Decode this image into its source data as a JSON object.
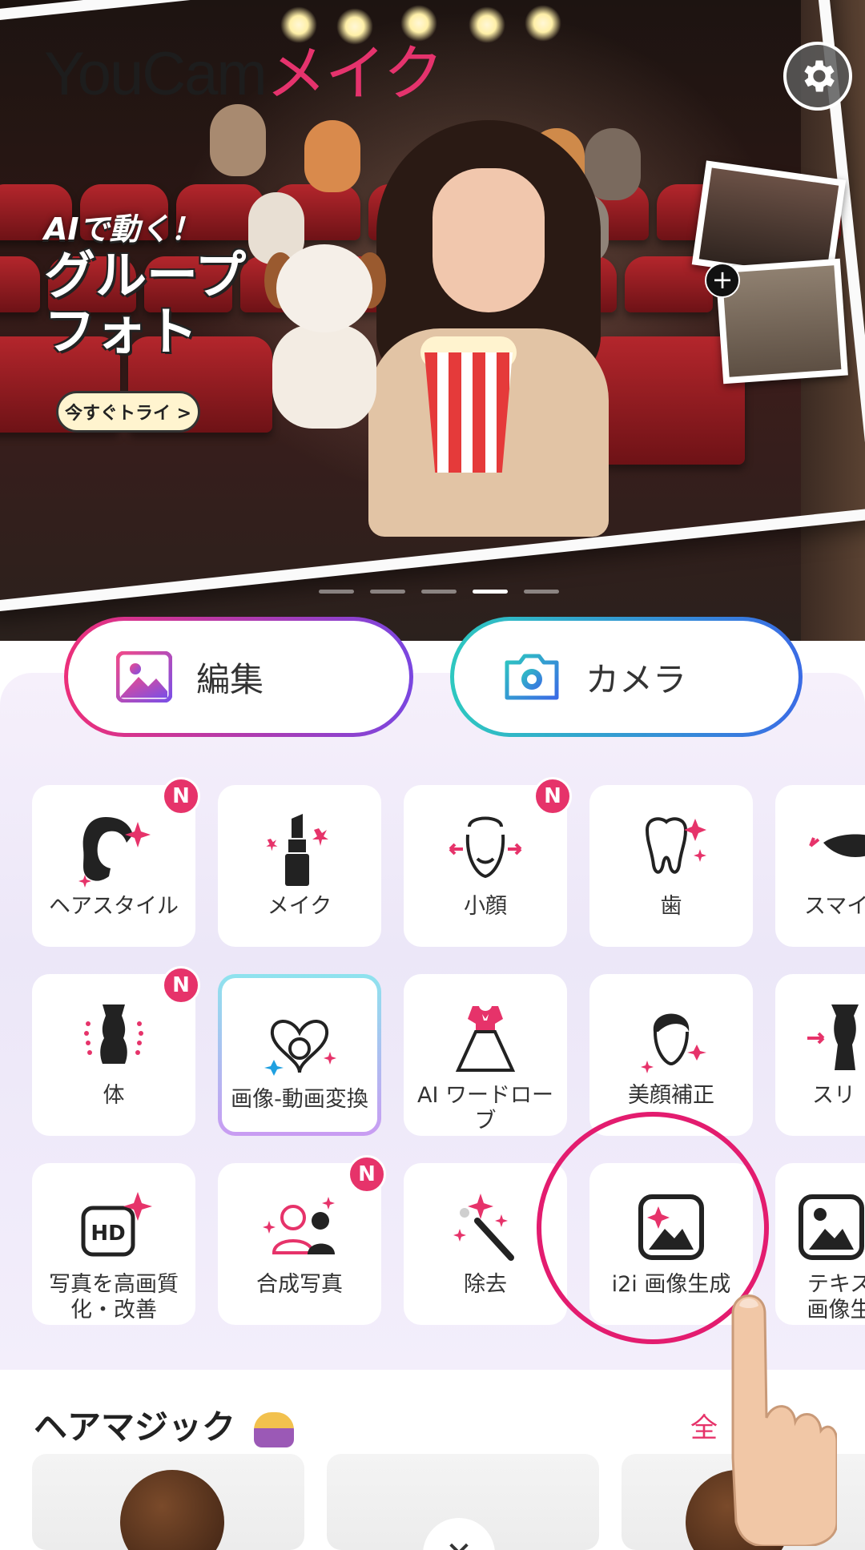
{
  "hero": {
    "logo_part1": "YouCam",
    "logo_part2": "メイク",
    "promo_line1": "AIで動く！",
    "promo_line2": "グループ\nフォト",
    "try_label": "今すぐトライ >",
    "carousel_active_index": 3,
    "carousel_count": 5
  },
  "actions": {
    "edit_label": "編集",
    "camera_label": "カメラ"
  },
  "features": {
    "row1": [
      {
        "label": "ヘアスタイル",
        "icon": "hairstyle-icon",
        "new": true
      },
      {
        "label": "メイク",
        "icon": "lipstick-icon",
        "new": false
      },
      {
        "label": "小顔",
        "icon": "face-slim-icon",
        "new": true
      },
      {
        "label": "歯",
        "icon": "tooth-icon",
        "new": false
      },
      {
        "label": "スマイ",
        "icon": "smile-lips-icon",
        "new": false
      }
    ],
    "row2": [
      {
        "label": "体",
        "icon": "body-icon",
        "new": true
      },
      {
        "label": "画像-動画変換",
        "icon": "image-to-video-icon",
        "new": false
      },
      {
        "label": "AI ワードローブ",
        "icon": "dress-icon",
        "new": false
      },
      {
        "label": "美顔補正",
        "icon": "beauty-face-icon",
        "new": false
      },
      {
        "label": "スリ",
        "icon": "slim-body-icon",
        "new": false
      }
    ],
    "row3": [
      {
        "label": "写真を高画質化・改善",
        "icon": "hd-icon",
        "new": false
      },
      {
        "label": "合成写真",
        "icon": "group-photo-icon",
        "new": true
      },
      {
        "label": "除去",
        "icon": "magic-wand-icon",
        "new": false
      },
      {
        "label": "i2i 画像生成",
        "icon": "image-generate-icon",
        "new": false
      },
      {
        "label": "テキス画像生",
        "icon": "text-to-image-icon",
        "new": false
      }
    ],
    "new_badge": "N"
  },
  "hair_magic": {
    "title": "ヘアマジック",
    "see_all": "全"
  },
  "colors": {
    "accent_pink": "#e6336a",
    "highlight_circle": "#e31c6f"
  }
}
